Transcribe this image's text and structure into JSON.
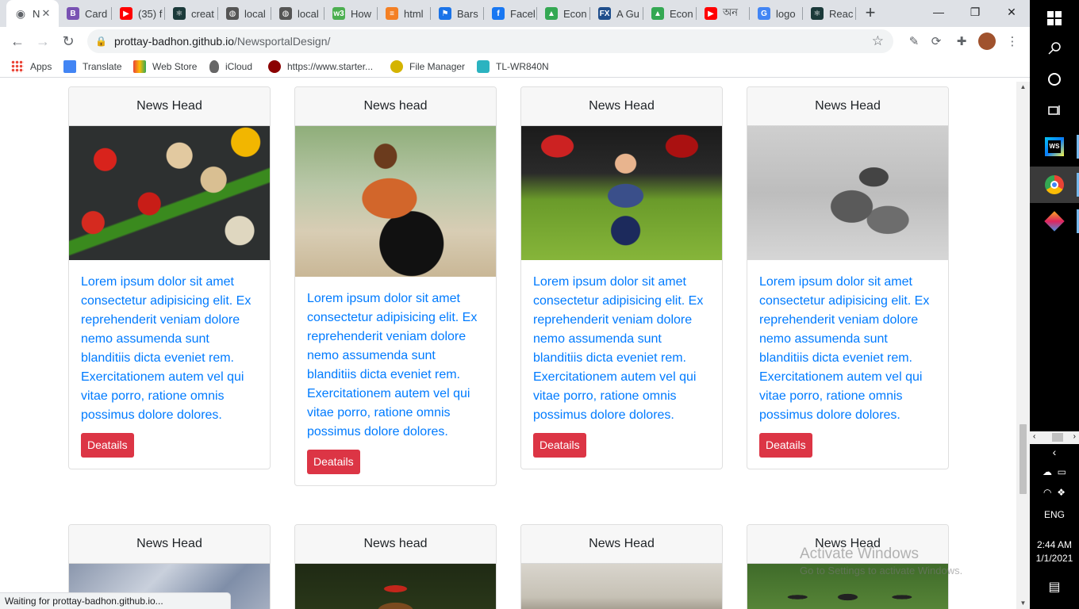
{
  "browser": {
    "tabs": [
      {
        "label": "N",
        "color": "#5f6368",
        "glyph": "◉"
      },
      {
        "label": "Card",
        "color": "#7952b3",
        "glyph": "B"
      },
      {
        "label": "(35) f",
        "color": "#ff0000",
        "glyph": "▶"
      },
      {
        "label": "creat",
        "color": "#1b3a3a",
        "glyph": "⚛"
      },
      {
        "label": "local",
        "color": "#555",
        "glyph": "◍"
      },
      {
        "label": "local",
        "color": "#555",
        "glyph": "◍"
      },
      {
        "label": "How",
        "color": "#4caf50",
        "glyph": "w3"
      },
      {
        "label": "html",
        "color": "#f48024",
        "glyph": "≡"
      },
      {
        "label": "Bars",
        "color": "#1a73e8",
        "glyph": "⚑"
      },
      {
        "label": "Facel",
        "color": "#1877f2",
        "glyph": "f"
      },
      {
        "label": "Econ",
        "color": "#34a853",
        "glyph": "▲"
      },
      {
        "label": "A Gu",
        "color": "#1f4e8c",
        "glyph": "FX"
      },
      {
        "label": "Econ",
        "color": "#34a853",
        "glyph": "▲"
      },
      {
        "label": "অন",
        "color": "#ff0000",
        "glyph": "▶"
      },
      {
        "label": "logo",
        "color": "#4285f4",
        "glyph": "G"
      },
      {
        "label": "Reac",
        "color": "#1b3a3a",
        "glyph": "⚛"
      }
    ],
    "new_tab_glyph": "+",
    "address": {
      "host": "prottay-badhon.github.io",
      "path": "/NewsportalDesign/"
    },
    "bookmarks": [
      {
        "label": "Apps",
        "color": "#4285f4"
      },
      {
        "label": "Translate",
        "color": "#4285f4"
      },
      {
        "label": "Web Store",
        "color": "#ea4335"
      },
      {
        "label": "iCloud",
        "color": "#555"
      },
      {
        "label": "https://www.starter...",
        "color": "#b00"
      },
      {
        "label": "File Manager",
        "color": "#c9a400"
      },
      {
        "label": "TL-WR840N",
        "color": "#2bb3c0"
      }
    ],
    "status": "Waiting for prottay-badhon.github.io..."
  },
  "cards_row1": [
    {
      "head": "News Head",
      "text": "Lorem ipsum dolor sit amet consectetur adipisicing elit. Ex reprehenderit veniam dolore nemo assumenda sunt blanditiis dicta eveniet rem. Exercitationem autem vel qui vitae porro, ratione omnis possimus dolore dolores.",
      "button": "Deatails"
    },
    {
      "head": "News head",
      "text": "Lorem ipsum dolor sit amet consectetur adipisicing elit. Ex reprehenderit veniam dolore nemo assumenda sunt blanditiis dicta eveniet rem. Exercitationem autem vel qui vitae porro, ratione omnis possimus dolore dolores.",
      "button": "Deatails"
    },
    {
      "head": "News Head",
      "text": "Lorem ipsum dolor sit amet consectetur adipisicing elit. Ex reprehenderit veniam dolore nemo assumenda sunt blanditiis dicta eveniet rem. Exercitationem autem vel qui vitae porro, ratione omnis possimus dolore dolores.",
      "button": "Deatails"
    },
    {
      "head": "News Head",
      "text": "Lorem ipsum dolor sit amet consectetur adipisicing elit. Ex reprehenderit veniam dolore nemo assumenda sunt blanditiis dicta eveniet rem. Exercitationem autem vel qui vitae porro, ratione omnis possimus dolore dolores.",
      "button": "Deatails"
    }
  ],
  "cards_row2": [
    {
      "head": "News Head"
    },
    {
      "head": "News head"
    },
    {
      "head": "News Head"
    },
    {
      "head": "News Head"
    }
  ],
  "watermark": {
    "title": "Activate Windows",
    "subtitle": "Go to Settings to activate Windows."
  },
  "taskbar": {
    "lang": "ENG",
    "time": "2:44 AM",
    "date": "1/1/2021"
  }
}
